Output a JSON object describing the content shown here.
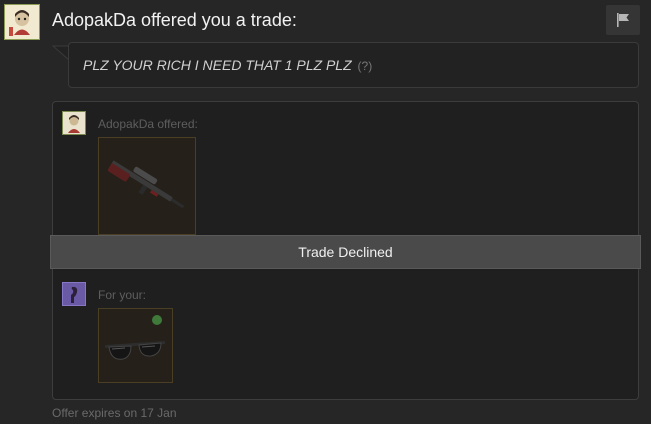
{
  "header": {
    "title": "AdopakDa offered you a trade:",
    "report_icon": "flag-icon"
  },
  "message": {
    "text": "PLZ YOUR RICH I NEED THAT 1 PLZ PLZ",
    "help": "(?)"
  },
  "trade": {
    "them": {
      "label": "AdopakDa offered:",
      "item_icon": "rifle-icon"
    },
    "me": {
      "label": "For your:",
      "item_icon": "sunglasses-icon"
    },
    "status": "Trade Declined"
  },
  "footer": {
    "expires": "Offer expires on 17 Jan"
  },
  "colors": {
    "background": "#262626",
    "panel": "#1f1f1f",
    "status_bar": "#4a4a4a",
    "item_border": "#4a3f24"
  }
}
